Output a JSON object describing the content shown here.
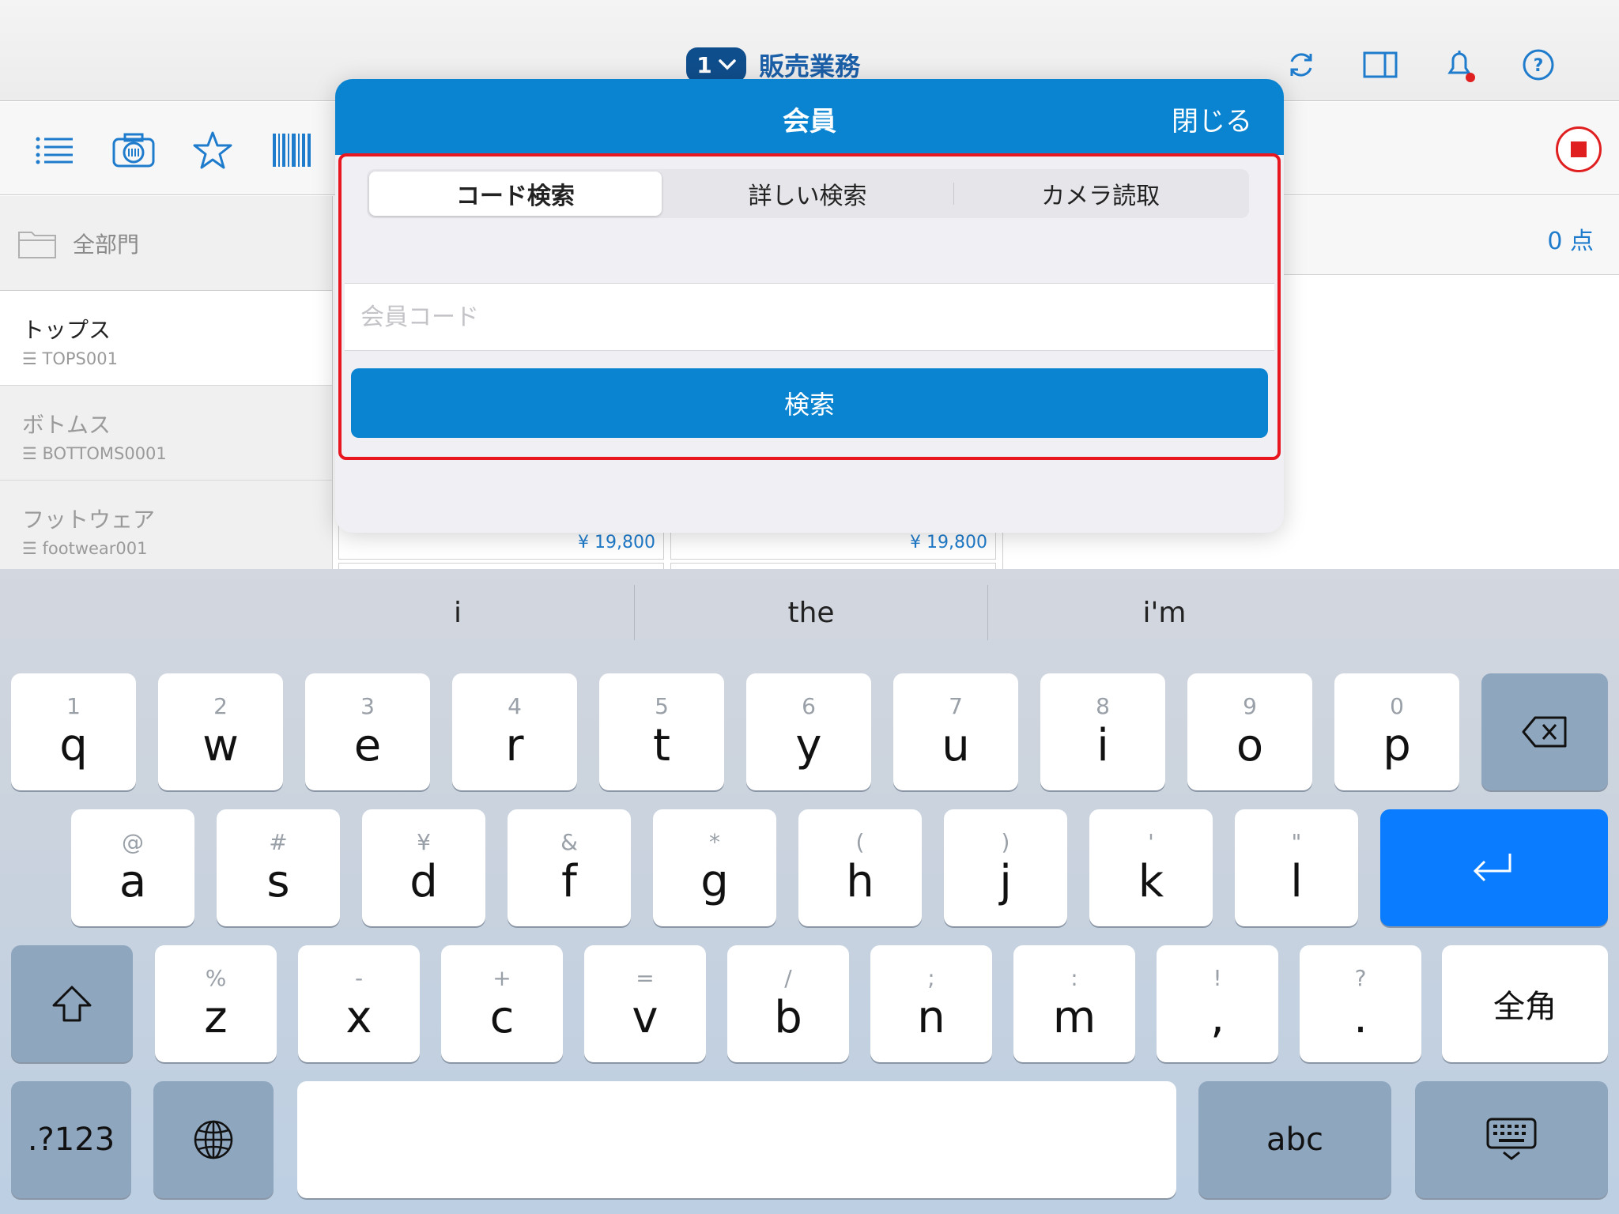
{
  "topbar": {
    "session_number": "1",
    "app_title": "販売業務",
    "icons": [
      "refresh-icon",
      "split-view-icon",
      "bell-icon",
      "help-icon"
    ]
  },
  "toolbar": {
    "icons": [
      "menu-list-icon",
      "camera-scan-icon",
      "star-icon",
      "barcode-icon"
    ]
  },
  "left_panel": {
    "department_label": "全部門",
    "categories": [
      {
        "name": "トップス",
        "code": "☰ TOPS001"
      },
      {
        "name": "ボトムス",
        "code": "☰ BOTTOMS0001"
      },
      {
        "name": "フットウェア",
        "code": "☰ footwear001"
      }
    ]
  },
  "right_panel": {
    "count": "0 点"
  },
  "products": {
    "prices": [
      "¥ 19,800",
      "¥ 19,800"
    ]
  },
  "modal": {
    "title": "会員",
    "close_label": "閉じる",
    "tabs": [
      {
        "label": "コード検索",
        "active": true
      },
      {
        "label": "詳しい検索",
        "active": false
      },
      {
        "label": "カメラ読取",
        "active": false
      }
    ],
    "member_code": {
      "placeholder": "会員コード",
      "value": ""
    },
    "search_label": "検索"
  },
  "keyboard": {
    "suggestions": [
      "i",
      "the",
      "i'm"
    ],
    "row1": [
      {
        "alt": "1",
        "key": "q"
      },
      {
        "alt": "2",
        "key": "w"
      },
      {
        "alt": "3",
        "key": "e"
      },
      {
        "alt": "4",
        "key": "r"
      },
      {
        "alt": "5",
        "key": "t"
      },
      {
        "alt": "6",
        "key": "y"
      },
      {
        "alt": "7",
        "key": "u"
      },
      {
        "alt": "8",
        "key": "i"
      },
      {
        "alt": "9",
        "key": "o"
      },
      {
        "alt": "0",
        "key": "p"
      }
    ],
    "row2": [
      {
        "alt": "@",
        "key": "a"
      },
      {
        "alt": "#",
        "key": "s"
      },
      {
        "alt": "¥",
        "key": "d"
      },
      {
        "alt": "&",
        "key": "f"
      },
      {
        "alt": "*",
        "key": "g"
      },
      {
        "alt": "(",
        "key": "h"
      },
      {
        "alt": ")",
        "key": "j"
      },
      {
        "alt": "'",
        "key": "k"
      },
      {
        "alt": "\"",
        "key": "l"
      }
    ],
    "row3": [
      {
        "alt": "%",
        "key": "z"
      },
      {
        "alt": "-",
        "key": "x"
      },
      {
        "alt": "+",
        "key": "c"
      },
      {
        "alt": "=",
        "key": "v"
      },
      {
        "alt": "/",
        "key": "b"
      },
      {
        "alt": ";",
        "key": "n"
      },
      {
        "alt": ":",
        "key": "m"
      },
      {
        "alt": "!",
        "key": ","
      },
      {
        "alt": "?",
        "key": "."
      }
    ],
    "fullwidth_label": "全角",
    "numbers_label": ".?123",
    "abc_label": "abc",
    "colors": {
      "accent": "#0a84d0",
      "return_key": "#0a7cff",
      "highlight": "#e8161e"
    }
  }
}
